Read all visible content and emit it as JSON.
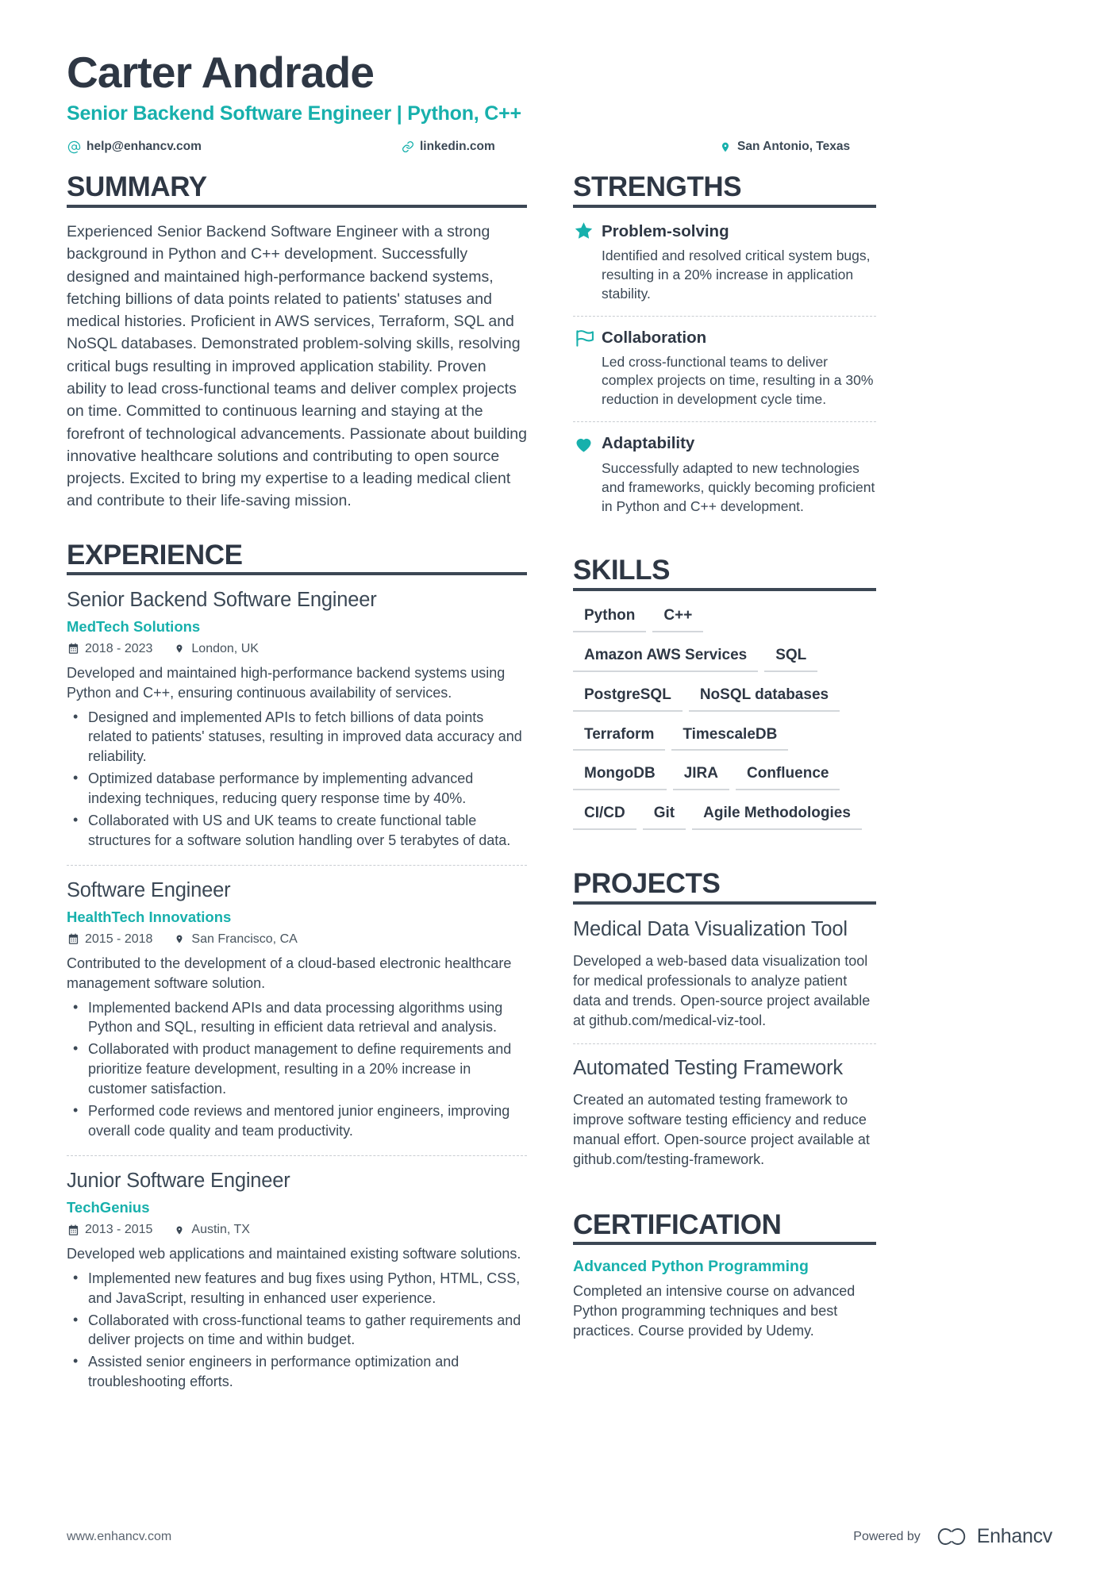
{
  "header": {
    "name": "Carter Andrade",
    "title": "Senior Backend Software Engineer | Python, C++",
    "contacts": [
      {
        "icon": "at-icon",
        "text": "help@enhancv.com"
      },
      {
        "icon": "link-icon",
        "text": "linkedin.com"
      },
      {
        "icon": "location-pin-icon",
        "text": "San Antonio, Texas"
      }
    ]
  },
  "summary": {
    "heading": "SUMMARY",
    "text": "Experienced Senior Backend Software Engineer with a strong background in Python and C++ development. Successfully designed and maintained high-performance backend systems, fetching billions of data points related to patients' statuses and medical histories. Proficient in AWS services, Terraform, SQL and NoSQL databases. Demonstrated problem-solving skills, resolving critical bugs resulting in improved application stability. Proven ability to lead cross-functional teams and deliver complex projects on time. Committed to continuous learning and staying at the forefront of technological advancements. Passionate about building innovative healthcare solutions and contributing to open source projects. Excited to bring my expertise to a leading medical client and contribute to their life-saving mission."
  },
  "experience": {
    "heading": "EXPERIENCE",
    "jobs": [
      {
        "title": "Senior Backend Software Engineer",
        "company": "MedTech Solutions",
        "dates": "2018 - 2023",
        "location": "London, UK",
        "description": "Developed and maintained high-performance backend systems using Python and C++, ensuring continuous availability of services.",
        "bullets": [
          "Designed and implemented APIs to fetch billions of data points related to patients' statuses, resulting in improved data accuracy and reliability.",
          "Optimized database performance by implementing advanced indexing techniques, reducing query response time by 40%.",
          "Collaborated with US and UK teams to create functional table structures for a software solution handling over 5 terabytes of data."
        ]
      },
      {
        "title": "Software Engineer",
        "company": "HealthTech Innovations",
        "dates": "2015 - 2018",
        "location": "San Francisco, CA",
        "description": "Contributed to the development of a cloud-based electronic healthcare management software solution.",
        "bullets": [
          "Implemented backend APIs and data processing algorithms using Python and SQL, resulting in efficient data retrieval and analysis.",
          "Collaborated with product management to define requirements and prioritize feature development, resulting in a 20% increase in customer satisfaction.",
          "Performed code reviews and mentored junior engineers, improving overall code quality and team productivity."
        ]
      },
      {
        "title": "Junior Software Engineer",
        "company": "TechGenius",
        "dates": "2013 - 2015",
        "location": "Austin, TX",
        "description": "Developed web applications and maintained existing software solutions.",
        "bullets": [
          "Implemented new features and bug fixes using Python, HTML, CSS, and JavaScript, resulting in enhanced user experience.",
          "Collaborated with cross-functional teams to gather requirements and deliver projects on time and within budget.",
          "Assisted senior engineers in performance optimization and troubleshooting efforts."
        ]
      }
    ]
  },
  "strengths": {
    "heading": "STRENGTHS",
    "items": [
      {
        "icon": "star-icon",
        "name": "Problem-solving",
        "description": "Identified and resolved critical system bugs, resulting in a 20% increase in application stability."
      },
      {
        "icon": "flag-icon",
        "name": "Collaboration",
        "description": "Led cross-functional teams to deliver complex projects on time, resulting in a 30% reduction in development cycle time."
      },
      {
        "icon": "heart-icon",
        "name": "Adaptability",
        "description": "Successfully adapted to new technologies and frameworks, quickly becoming proficient in Python and C++ development."
      }
    ]
  },
  "skills": {
    "heading": "SKILLS",
    "items": [
      "Python",
      "C++",
      "Amazon AWS Services",
      "SQL",
      "PostgreSQL",
      "NoSQL databases",
      "Terraform",
      "TimescaleDB",
      "MongoDB",
      "JIRA",
      "Confluence",
      "CI/CD",
      "Git",
      "Agile Methodologies"
    ]
  },
  "projects": {
    "heading": "PROJECTS",
    "items": [
      {
        "title": "Medical Data Visualization Tool",
        "description": "Developed a web-based data visualization tool for medical professionals to analyze patient data and trends. Open-source project available at github.com/medical-viz-tool."
      },
      {
        "title": "Automated Testing Framework",
        "description": "Created an automated testing framework to improve software testing efficiency and reduce manual effort. Open-source project available at github.com/testing-framework."
      }
    ]
  },
  "certification": {
    "heading": "CERTIFICATION",
    "items": [
      {
        "title": "Advanced Python Programming",
        "description": "Completed an intensive course on advanced Python programming techniques and best practices. Course provided by Udemy."
      }
    ]
  },
  "footer": {
    "url": "www.enhancv.com",
    "powered_by": "Powered by",
    "brand": "Enhancv"
  },
  "colors": {
    "accent": "#17b0ac",
    "text": "#3b4855",
    "heading": "#2e3744"
  }
}
